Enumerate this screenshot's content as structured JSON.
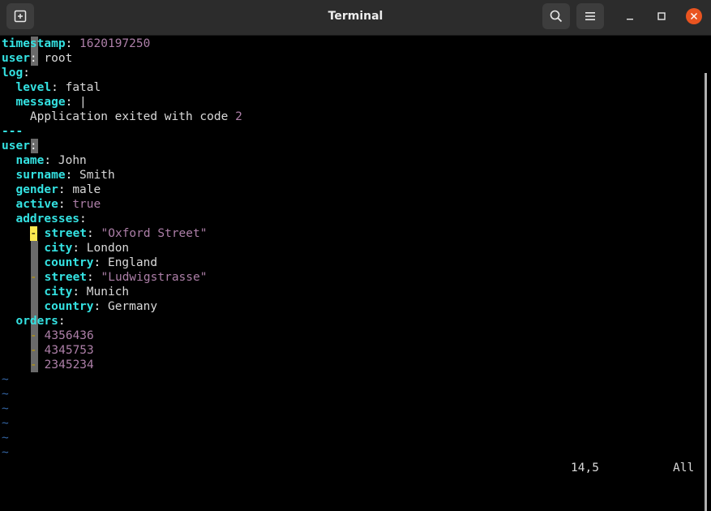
{
  "window": {
    "title": "Terminal",
    "new_tab_icon": "new-tab-icon",
    "search_icon": "search-icon",
    "menu_icon": "hamburger-menu-icon",
    "minimize_icon": "minimize-icon",
    "maximize_icon": "maximize-icon",
    "close_icon": "close-icon",
    "close_color": "#e95420"
  },
  "editor": {
    "lines": [
      {
        "indent": "",
        "key": "timestamp",
        "sep": ": ",
        "value": "1620197250",
        "value_type": "number"
      },
      {
        "indent": "",
        "key": "user",
        "sep": ": ",
        "value": "root",
        "value_type": "string"
      },
      {
        "indent": "",
        "key": "log",
        "sep": ":",
        "value": "",
        "value_type": "none"
      },
      {
        "indent": "  ",
        "key": "level",
        "sep": ": ",
        "value": "fatal",
        "value_type": "string"
      },
      {
        "indent": "  ",
        "key": "message",
        "sep": ": ",
        "value": "|",
        "value_type": "string"
      },
      {
        "indent": "    ",
        "key": "",
        "sep": "",
        "value": "Application exited with code ",
        "value_type": "string",
        "suffix": "2"
      },
      {
        "indent": "",
        "key": "",
        "sep": "",
        "value": "---",
        "value_type": "separator"
      },
      {
        "indent": "",
        "key": "user",
        "sep": ":",
        "value": "",
        "value_type": "none"
      },
      {
        "indent": "  ",
        "key": "name",
        "sep": ": ",
        "value": "John",
        "value_type": "string"
      },
      {
        "indent": "  ",
        "key": "surname",
        "sep": ": ",
        "value": "Smith",
        "value_type": "string"
      },
      {
        "indent": "  ",
        "key": "gender",
        "sep": ": ",
        "value": "male",
        "value_type": "string"
      },
      {
        "indent": "  ",
        "key": "active",
        "sep": ": ",
        "value": "true",
        "value_type": "number"
      },
      {
        "indent": "  ",
        "key": "addresses",
        "sep": ":",
        "value": "",
        "value_type": "none"
      },
      {
        "indent": "    ",
        "dash": "-",
        "dash_selected": true,
        "key": "street",
        "sep": ": ",
        "value": "\"Oxford Street\"",
        "value_type": "number"
      },
      {
        "indent": "      ",
        "key": "city",
        "sep": ": ",
        "value": "London",
        "value_type": "string"
      },
      {
        "indent": "      ",
        "key": "country",
        "sep": ": ",
        "value": "England",
        "value_type": "string"
      },
      {
        "indent": "    ",
        "dash": "-",
        "key": "street",
        "sep": ": ",
        "value": "\"Ludwigstrasse\"",
        "value_type": "number"
      },
      {
        "indent": "      ",
        "key": "city",
        "sep": ": ",
        "value": "Munich",
        "value_type": "string"
      },
      {
        "indent": "      ",
        "key": "country",
        "sep": ": ",
        "value": "Germany",
        "value_type": "string"
      },
      {
        "indent": "  ",
        "key": "orders",
        "sep": ":",
        "value": "",
        "value_type": "none"
      },
      {
        "indent": "    ",
        "dash": "-",
        "key": "",
        "sep": "",
        "value": "4356436",
        "value_type": "number"
      },
      {
        "indent": "    ",
        "dash": "-",
        "key": "",
        "sep": "",
        "value": "4345753",
        "value_type": "number"
      },
      {
        "indent": "    ",
        "dash": "-",
        "key": "",
        "sep": "",
        "value": "2345234",
        "value_type": "number"
      }
    ],
    "tilde": "~",
    "tilde_count": 6
  },
  "status": {
    "position": "14,5",
    "scroll": "All"
  },
  "colors": {
    "key": "#34e2e2",
    "number": "#ad7fa8",
    "tilde": "#3465a4",
    "selected_dash_bg": "#fce94f"
  }
}
